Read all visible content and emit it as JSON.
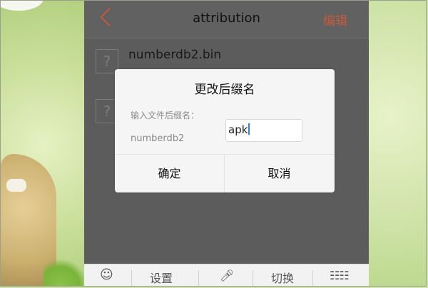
{
  "appbar": {
    "title": "attribution",
    "edit_label": "编辑",
    "back_icon": "chevron-left-icon"
  },
  "files": [
    {
      "name": "numberdb2.bin",
      "icon": "unknown-file-icon",
      "icon_glyph": "?"
    },
    {
      "name": "",
      "icon": "unknown-file-icon",
      "icon_glyph": "?"
    }
  ],
  "dialog": {
    "title": "更改后缀名",
    "prompt": "输入文件后缀名：",
    "base_name": "numberdb2",
    "suffix_value": "apk",
    "confirm_label": "确定",
    "cancel_label": "取消"
  },
  "keyboard_bar": {
    "emoji_icon": "smiley-icon",
    "settings_label": "设置",
    "mic_icon": "microphone-icon",
    "switch_label": "切换",
    "grid_icon": "keyboard-grid-icon"
  },
  "colors": {
    "accent": "#c45a3c",
    "overlay": "#5c5c5c",
    "caret": "#3a7bd5"
  }
}
